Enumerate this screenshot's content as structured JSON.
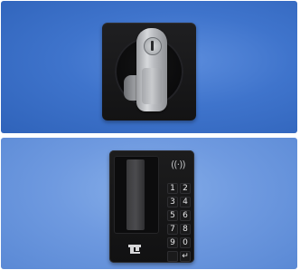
{
  "scene": {
    "panels": [
      {
        "name": "swing-handle-lock",
        "background": "#4a7ed3"
      },
      {
        "name": "keypad-lock",
        "background": "#7aa2e2"
      }
    ]
  },
  "keypad": {
    "rfid_symbol": "((·))",
    "keys": [
      "1",
      "2",
      "3",
      "4",
      "5",
      "6",
      "7",
      "8",
      "9",
      "0",
      "",
      "↵"
    ]
  },
  "icons": {
    "lock_icon": "keyhole-icon",
    "rfid_icon": "rfid-icon",
    "logo_icon": "brand-logo-icon"
  }
}
